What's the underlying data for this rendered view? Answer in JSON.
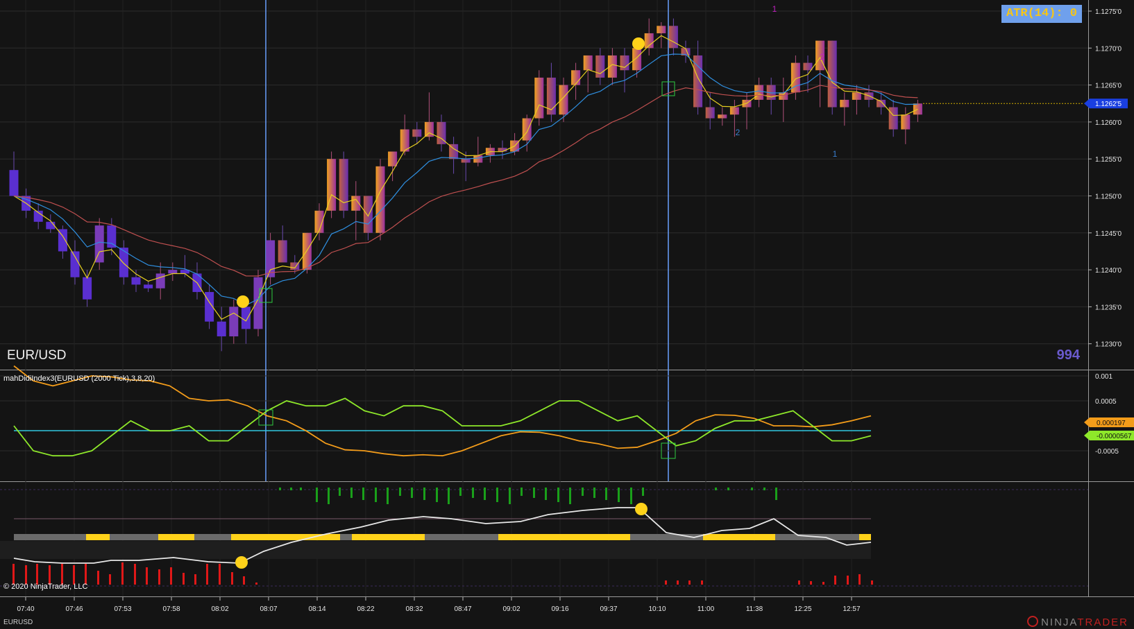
{
  "app": {
    "name": "NinjaTrader",
    "brand_prefix": "NINJA",
    "brand_suffix": "TRADER",
    "copyright": "© 2020 NinjaTrader, LLC"
  },
  "chart": {
    "symbol": "EUR/USD",
    "footer_symbol": "EURUSD",
    "tick_counter": "994",
    "atr_label": "ATR(14): 0",
    "current_price": "1.1262'5",
    "price_axis_ticks": [
      "1.1275'0",
      "1.1270'0",
      "1.1265'0",
      "1.1260'0",
      "1.1255'0",
      "1.1250'0",
      "1.1245'0",
      "1.1240'0",
      "1.1235'0",
      "1.1230'0"
    ],
    "time_axis_ticks": [
      "07:40",
      "07:46",
      "07:53",
      "07:58",
      "08:02",
      "08:07",
      "08:14",
      "08:22",
      "08:32",
      "08:47",
      "09:02",
      "09:16",
      "09:37",
      "10:10",
      "11:00",
      "11:38",
      "12:25",
      "12:57"
    ],
    "wave_labels": [
      {
        "text": "1",
        "color": "#c020c0"
      },
      {
        "text": "2",
        "color": "#c020c0"
      },
      {
        "text": "2",
        "color": "#3a7fd0"
      },
      {
        "text": "1",
        "color": "#3a7fd0"
      }
    ]
  },
  "indicator": {
    "title": "mahDidiIndex3(EURUSD (2000 Tick),3,8,20)",
    "axis_ticks": [
      "0.001",
      "0.0005",
      "-0.0005"
    ],
    "value_orange": "0.000197",
    "value_green": "-0.0000567"
  },
  "colors": {
    "background": "#141414",
    "ema_fast": "#e8d020",
    "ema_mid": "#2f8fe0",
    "ema_slow": "#c05050",
    "indicator_orange": "#f39c1a",
    "indicator_green": "#8ee82a",
    "zero_line": "#30c8e0",
    "marker_dot": "#ffd21a",
    "bull_histogram": "#1aa01a",
    "bear_histogram": "#e01818",
    "band_yellow": "#ffd21a",
    "band_gray": "#6a6a6a"
  },
  "chart_data": {
    "type": "candlestick",
    "timeframe": "2000 Tick",
    "candles": [
      {
        "o": 1.12535,
        "h": 1.1256,
        "l": 1.12505,
        "c": 1.125
      },
      {
        "o": 1.125,
        "h": 1.1251,
        "l": 1.1247,
        "c": 1.1248
      },
      {
        "o": 1.1248,
        "h": 1.1249,
        "l": 1.12455,
        "c": 1.12465
      },
      {
        "o": 1.12465,
        "h": 1.12475,
        "l": 1.1245,
        "c": 1.12455
      },
      {
        "o": 1.12455,
        "h": 1.1246,
        "l": 1.12415,
        "c": 1.12425
      },
      {
        "o": 1.12425,
        "h": 1.1244,
        "l": 1.1238,
        "c": 1.1239
      },
      {
        "o": 1.1239,
        "h": 1.124,
        "l": 1.1235,
        "c": 1.1236
      },
      {
        "o": 1.1241,
        "h": 1.1247,
        "l": 1.124,
        "c": 1.1246
      },
      {
        "o": 1.1246,
        "h": 1.1247,
        "l": 1.1242,
        "c": 1.1243
      },
      {
        "o": 1.1243,
        "h": 1.1244,
        "l": 1.1238,
        "c": 1.1239
      },
      {
        "o": 1.1239,
        "h": 1.124,
        "l": 1.1237,
        "c": 1.1238
      },
      {
        "o": 1.1238,
        "h": 1.12385,
        "l": 1.1237,
        "c": 1.12375
      },
      {
        "o": 1.12375,
        "h": 1.1241,
        "l": 1.1236,
        "c": 1.12395
      },
      {
        "o": 1.12395,
        "h": 1.1241,
        "l": 1.12385,
        "c": 1.124
      },
      {
        "o": 1.124,
        "h": 1.1242,
        "l": 1.1239,
        "c": 1.12395
      },
      {
        "o": 1.12395,
        "h": 1.1241,
        "l": 1.1236,
        "c": 1.1237
      },
      {
        "o": 1.1237,
        "h": 1.1238,
        "l": 1.1232,
        "c": 1.1233
      },
      {
        "o": 1.1233,
        "h": 1.1235,
        "l": 1.1229,
        "c": 1.1231
      },
      {
        "o": 1.1231,
        "h": 1.1236,
        "l": 1.123,
        "c": 1.1235
      },
      {
        "o": 1.1235,
        "h": 1.1236,
        "l": 1.123,
        "c": 1.1232
      },
      {
        "o": 1.1232,
        "h": 1.124,
        "l": 1.1231,
        "c": 1.1239
      },
      {
        "o": 1.1239,
        "h": 1.1245,
        "l": 1.1238,
        "c": 1.1244
      },
      {
        "o": 1.1244,
        "h": 1.1246,
        "l": 1.1242,
        "c": 1.1241
      },
      {
        "o": 1.1241,
        "h": 1.1242,
        "l": 1.12395,
        "c": 1.124
      },
      {
        "o": 1.124,
        "h": 1.1245,
        "l": 1.12395,
        "c": 1.1245
      },
      {
        "o": 1.1245,
        "h": 1.1249,
        "l": 1.1244,
        "c": 1.1248
      },
      {
        "o": 1.1248,
        "h": 1.1256,
        "l": 1.1247,
        "c": 1.1255
      },
      {
        "o": 1.1255,
        "h": 1.1256,
        "l": 1.1247,
        "c": 1.1248
      },
      {
        "o": 1.1248,
        "h": 1.1252,
        "l": 1.1244,
        "c": 1.125
      },
      {
        "o": 1.125,
        "h": 1.1247,
        "l": 1.1244,
        "c": 1.1245
      },
      {
        "o": 1.1245,
        "h": 1.1255,
        "l": 1.1244,
        "c": 1.1254
      },
      {
        "o": 1.1254,
        "h": 1.1256,
        "l": 1.1252,
        "c": 1.1256
      },
      {
        "o": 1.1256,
        "h": 1.1261,
        "l": 1.12555,
        "c": 1.1259
      },
      {
        "o": 1.1259,
        "h": 1.126,
        "l": 1.1257,
        "c": 1.1258
      },
      {
        "o": 1.1258,
        "h": 1.1264,
        "l": 1.12575,
        "c": 1.126
      },
      {
        "o": 1.126,
        "h": 1.1261,
        "l": 1.1256,
        "c": 1.1257
      },
      {
        "o": 1.1257,
        "h": 1.1258,
        "l": 1.1253,
        "c": 1.1255
      },
      {
        "o": 1.1255,
        "h": 1.1256,
        "l": 1.1252,
        "c": 1.12545
      },
      {
        "o": 1.12545,
        "h": 1.1258,
        "l": 1.1254,
        "c": 1.12555
      },
      {
        "o": 1.12555,
        "h": 1.1257,
        "l": 1.12545,
        "c": 1.12565
      },
      {
        "o": 1.12565,
        "h": 1.12575,
        "l": 1.1255,
        "c": 1.1256
      },
      {
        "o": 1.1256,
        "h": 1.12585,
        "l": 1.12555,
        "c": 1.12575
      },
      {
        "o": 1.12575,
        "h": 1.1261,
        "l": 1.1256,
        "c": 1.12605
      },
      {
        "o": 1.12605,
        "h": 1.1267,
        "l": 1.12595,
        "c": 1.1266
      },
      {
        "o": 1.1266,
        "h": 1.1268,
        "l": 1.126,
        "c": 1.1261
      },
      {
        "o": 1.1261,
        "h": 1.1266,
        "l": 1.126,
        "c": 1.1265
      },
      {
        "o": 1.1265,
        "h": 1.1268,
        "l": 1.1263,
        "c": 1.1267
      },
      {
        "o": 1.1267,
        "h": 1.1269,
        "l": 1.1264,
        "c": 1.1269
      },
      {
        "o": 1.1269,
        "h": 1.127,
        "l": 1.1265,
        "c": 1.1266
      },
      {
        "o": 1.1266,
        "h": 1.127,
        "l": 1.1265,
        "c": 1.1269
      },
      {
        "o": 1.1269,
        "h": 1.127,
        "l": 1.1264,
        "c": 1.1267
      },
      {
        "o": 1.1267,
        "h": 1.127,
        "l": 1.1266,
        "c": 1.127
      },
      {
        "o": 1.127,
        "h": 1.1274,
        "l": 1.1269,
        "c": 1.1272
      },
      {
        "o": 1.1272,
        "h": 1.12735,
        "l": 1.127,
        "c": 1.1273
      },
      {
        "o": 1.1273,
        "h": 1.1274,
        "l": 1.1269,
        "c": 1.127
      },
      {
        "o": 1.127,
        "h": 1.1271,
        "l": 1.1268,
        "c": 1.1269
      },
      {
        "o": 1.1269,
        "h": 1.1271,
        "l": 1.1261,
        "c": 1.1262
      },
      {
        "o": 1.1262,
        "h": 1.1264,
        "l": 1.1259,
        "c": 1.12605
      },
      {
        "o": 1.12605,
        "h": 1.1262,
        "l": 1.12595,
        "c": 1.1261
      },
      {
        "o": 1.1261,
        "h": 1.1263,
        "l": 1.1258,
        "c": 1.1262
      },
      {
        "o": 1.1262,
        "h": 1.1264,
        "l": 1.1259,
        "c": 1.1263
      },
      {
        "o": 1.1263,
        "h": 1.1266,
        "l": 1.1262,
        "c": 1.1265
      },
      {
        "o": 1.1265,
        "h": 1.1266,
        "l": 1.1261,
        "c": 1.1263
      },
      {
        "o": 1.1263,
        "h": 1.1266,
        "l": 1.126,
        "c": 1.1264
      },
      {
        "o": 1.1264,
        "h": 1.1269,
        "l": 1.1263,
        "c": 1.1268
      },
      {
        "o": 1.1268,
        "h": 1.1269,
        "l": 1.1264,
        "c": 1.1267
      },
      {
        "o": 1.1267,
        "h": 1.1271,
        "l": 1.1262,
        "c": 1.1271
      },
      {
        "o": 1.1271,
        "h": 1.1271,
        "l": 1.1261,
        "c": 1.1262
      },
      {
        "o": 1.1262,
        "h": 1.1264,
        "l": 1.12595,
        "c": 1.1263
      },
      {
        "o": 1.1263,
        "h": 1.1265,
        "l": 1.1261,
        "c": 1.1264
      },
      {
        "o": 1.1264,
        "h": 1.1265,
        "l": 1.1262,
        "c": 1.1263
      },
      {
        "o": 1.1263,
        "h": 1.1264,
        "l": 1.1261,
        "c": 1.1262
      },
      {
        "o": 1.1262,
        "h": 1.1263,
        "l": 1.1258,
        "c": 1.1259
      },
      {
        "o": 1.1259,
        "h": 1.1262,
        "l": 1.1257,
        "c": 1.1261
      },
      {
        "o": 1.1261,
        "h": 1.1263,
        "l": 1.126,
        "c": 1.12625
      }
    ]
  }
}
